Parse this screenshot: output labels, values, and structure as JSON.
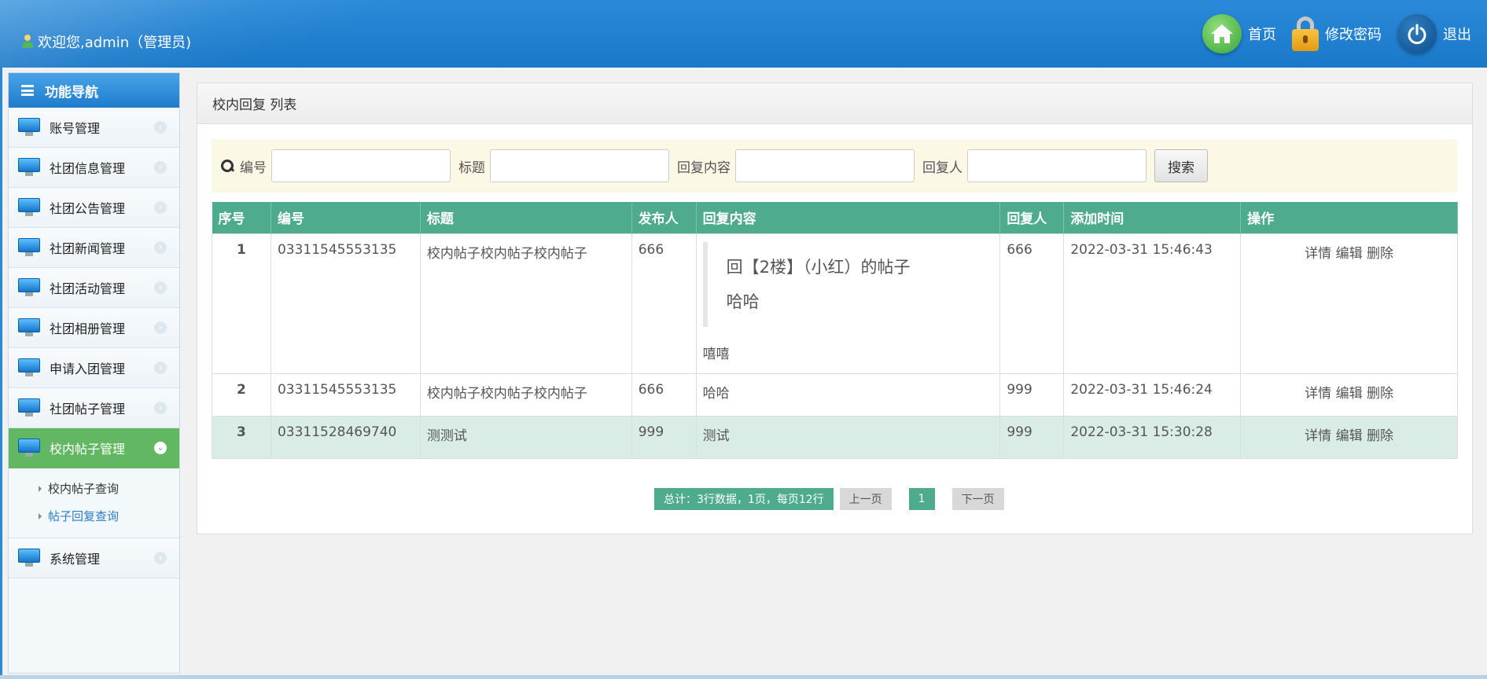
{
  "header": {
    "welcome": "欢迎您,admin（管理员)",
    "links": [
      {
        "label": "首页",
        "icon": "home-icon"
      },
      {
        "label": "修改密码",
        "icon": "lock-icon"
      },
      {
        "label": "退出",
        "icon": "power-icon"
      }
    ]
  },
  "sidebar": {
    "title": "功能导航",
    "items": [
      {
        "label": "账号管理"
      },
      {
        "label": "社团信息管理"
      },
      {
        "label": "社团公告管理"
      },
      {
        "label": "社团新闻管理"
      },
      {
        "label": "社团活动管理"
      },
      {
        "label": "社团相册管理"
      },
      {
        "label": "申请入团管理"
      },
      {
        "label": "社团帖子管理"
      },
      {
        "label": "校内帖子管理"
      },
      {
        "label": "系统管理"
      }
    ],
    "sub_items": [
      {
        "label": "校内帖子查询"
      },
      {
        "label": "帖子回复查询"
      }
    ]
  },
  "panel": {
    "title": "校内回复 列表"
  },
  "search": {
    "fields": [
      "编号",
      "标题",
      "回复内容",
      "回复人"
    ],
    "button": "搜索"
  },
  "table": {
    "columns": [
      "序号",
      "编号",
      "标题",
      "发布人",
      "回复内容",
      "回复人",
      "添加时间",
      "操作"
    ],
    "rows": [
      {
        "idx": "1",
        "code": "03311545553135",
        "title": "校内帖子校内帖子校内帖子",
        "author": "666",
        "quote_line1": "回【2楼】（小红）的帖子",
        "quote_line2": "哈哈",
        "content": "嘻嘻",
        "replier": "666",
        "time": "2022-03-31 15:46:43"
      },
      {
        "idx": "2",
        "code": "03311545553135",
        "title": "校内帖子校内帖子校内帖子",
        "author": "666",
        "content": "哈哈",
        "replier": "999",
        "time": "2022-03-31 15:46:24"
      },
      {
        "idx": "3",
        "code": "03311528469740",
        "title": "测测试",
        "author": "999",
        "content": "测试",
        "replier": "999",
        "time": "2022-03-31 15:30:28"
      }
    ],
    "ops": [
      "详情",
      "编辑",
      "删除"
    ]
  },
  "pager": {
    "info": "总计：3行数据，1页，每页12行",
    "prev": "上一页",
    "current": "1",
    "next": "下一页"
  }
}
